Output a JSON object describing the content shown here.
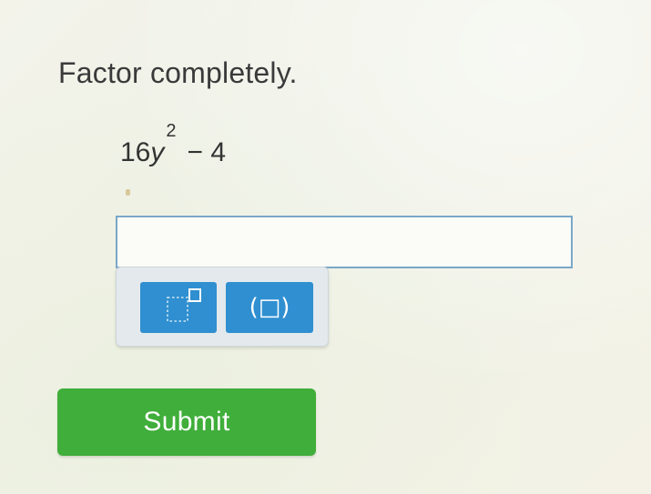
{
  "question": {
    "prompt": "Factor completely.",
    "expression": {
      "coefficient": "16",
      "variable": "y",
      "exponent": "2",
      "rest": "− 4"
    }
  },
  "answer": {
    "value": "",
    "placeholder": ""
  },
  "keypad": {
    "exponent_key": {
      "icon": "exponent-template-icon"
    },
    "parens_key": {
      "label": "(□)"
    }
  },
  "submit": {
    "label": "Submit"
  },
  "colors": {
    "submit_green": "#3fae3a",
    "key_blue": "#2f8fd0",
    "input_border": "#7aa7c8"
  }
}
